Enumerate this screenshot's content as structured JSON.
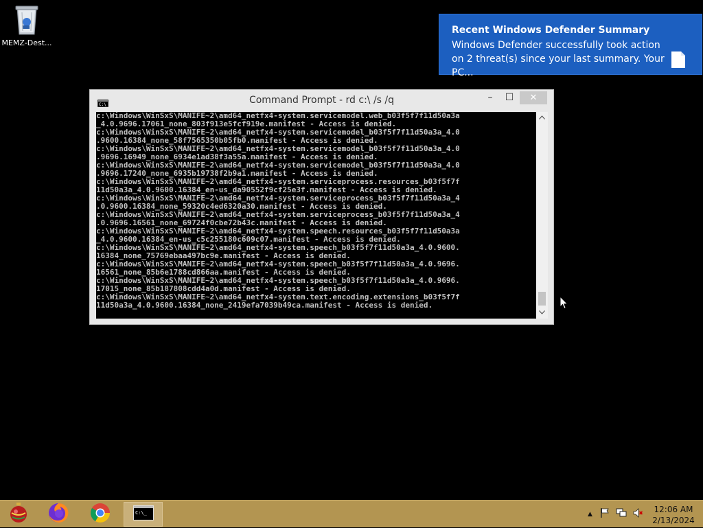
{
  "desktop": {
    "icons": [
      {
        "label": "MEMZ-Dest...",
        "icon": "recycle-bin-icon"
      }
    ]
  },
  "notification": {
    "title": "Recent Windows Defender Summary",
    "body": "Windows Defender successfully took action on 2 threat(s) since your last summary. Your PC...",
    "icon": "document-icon",
    "bg_color": "#1c5fc0"
  },
  "cmd": {
    "title": "Command Prompt - rd  c:\\ /s /q",
    "buttons": {
      "minimize": "–",
      "maximize": "☐",
      "close": "✕"
    },
    "lines": [
      "c:\\Windows\\WinSxS\\MANIFE~2\\amd64_netfx4-system.servicemodel.web_b03f5f7f11d50a3a",
      "_4.0.9696.17061_none_803f913e5fcf919e.manifest - Access is denied.",
      "c:\\Windows\\WinSxS\\MANIFE~2\\amd64_netfx4-system.servicemodel_b03f5f7f11d50a3a_4.0",
      ".9600.16384_none_58f7565350b05fb0.manifest - Access is denied.",
      "c:\\Windows\\WinSxS\\MANIFE~2\\amd64_netfx4-system.servicemodel_b03f5f7f11d50a3a_4.0",
      ".9696.16949_none_6934e1ad38f3a55a.manifest - Access is denied.",
      "c:\\Windows\\WinSxS\\MANIFE~2\\amd64_netfx4-system.servicemodel_b03f5f7f11d50a3a_4.0",
      ".9696.17240_none_6935b19738f2b9a1.manifest - Access is denied.",
      "c:\\Windows\\WinSxS\\MANIFE~2\\amd64_netfx4-system.serviceprocess.resources_b03f5f7f",
      "11d50a3a_4.0.9600.16384_en-us_da90552f9cf25e3f.manifest - Access is denied.",
      "c:\\Windows\\WinSxS\\MANIFE~2\\amd64_netfx4-system.serviceprocess_b03f5f7f11d50a3a_4",
      ".0.9600.16384_none_59320c4ed6320a30.manifest - Access is denied.",
      "c:\\Windows\\WinSxS\\MANIFE~2\\amd64_netfx4-system.serviceprocess_b03f5f7f11d50a3a_4",
      ".0.9696.16561_none_69724f0cbe72b43c.manifest - Access is denied.",
      "c:\\Windows\\WinSxS\\MANIFE~2\\amd64_netfx4-system.speech.resources_b03f5f7f11d50a3a",
      "_4.0.9600.16384_en-us_c5c255180c609c07.manifest - Access is denied.",
      "c:\\Windows\\WinSxS\\MANIFE~2\\amd64_netfx4-system.speech_b03f5f7f11d50a3a_4.0.9600.",
      "16384_none_75769ebaa497bc9e.manifest - Access is denied.",
      "c:\\Windows\\WinSxS\\MANIFE~2\\amd64_netfx4-system.speech_b03f5f7f11d50a3a_4.0.9696.",
      "16561_none_85b6e1788cd866aa.manifest - Access is denied.",
      "c:\\Windows\\WinSxS\\MANIFE~2\\amd64_netfx4-system.speech_b03f5f7f11d50a3a_4.0.9696.",
      "17015_none_85b187808cdd4a0d.manifest - Access is denied.",
      "c:\\Windows\\WinSxS\\MANIFE~2\\amd64_netfx4-system.text.encoding.extensions_b03f5f7f",
      "11d50a3a_4.0.9600.16384_none_2419efa7039b49ca.manifest - Access is denied."
    ]
  },
  "taskbar": {
    "apps": [
      {
        "name": "memz-ornament-icon"
      },
      {
        "name": "firefox-icon"
      },
      {
        "name": "chrome-icon"
      },
      {
        "name": "command-prompt-icon",
        "active": true
      }
    ],
    "tray": {
      "time": "12:06 AM",
      "date": "2/13/2024"
    },
    "bg_color": "#b39551"
  }
}
